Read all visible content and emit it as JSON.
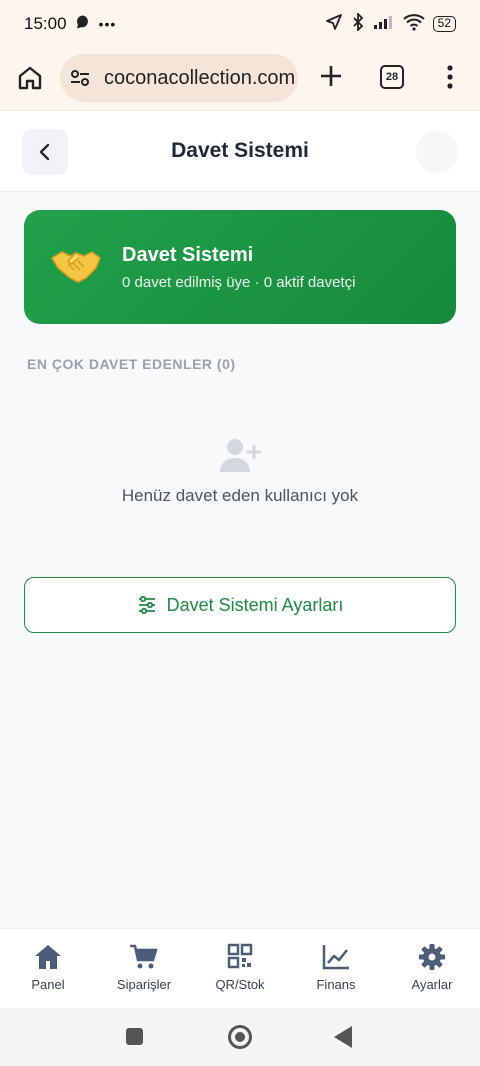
{
  "status_bar": {
    "time": "15:00",
    "battery": "52"
  },
  "browser": {
    "url": "coconacollection.com",
    "tab_count": "28"
  },
  "header": {
    "title": "Davet Sistemi"
  },
  "hero": {
    "title": "Davet Sistemi",
    "subtitle": "0 davet edilmiş üye · 0 aktif davetçi",
    "icon": "handshake-emoji",
    "color": "#1c9a46"
  },
  "section": {
    "label": "EN ÇOK DAVET EDENLER (0)"
  },
  "empty_state": {
    "icon": "add-user-icon",
    "text": "Henüz davet eden kullanıcı yok"
  },
  "settings_button": {
    "label": "Davet Sistemi Ayarları",
    "icon": "sliders-icon"
  },
  "bottom_nav": {
    "items": [
      {
        "label": "Panel",
        "icon": "home-icon"
      },
      {
        "label": "Siparişler",
        "icon": "cart-icon"
      },
      {
        "label": "QR/Stok",
        "icon": "qr-icon"
      },
      {
        "label": "Finans",
        "icon": "chart-icon"
      },
      {
        "label": "Ayarlar",
        "icon": "gear-icon"
      }
    ]
  },
  "colors": {
    "accent": "#1f8b45",
    "nav_icon": "#4b5d7a",
    "muted": "#9aa1ab"
  }
}
